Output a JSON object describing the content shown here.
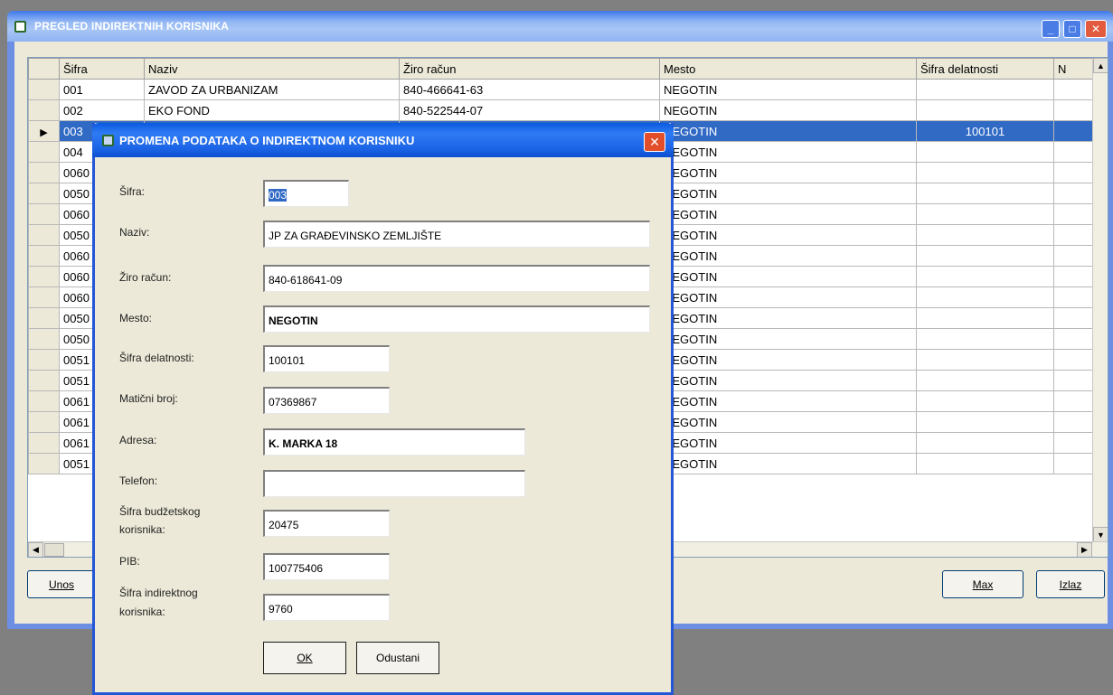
{
  "main_window": {
    "title": "PREGLED INDIREKTNIH KORISNIKA",
    "columns": [
      "Šifra",
      "Naziv",
      "Žiro račun",
      "Mesto",
      "Šifra delatnosti",
      "N"
    ],
    "rows": [
      {
        "sifra": "001",
        "naziv": "ZAVOD ZA URBANIZAM",
        "ziro": "840-466641-63",
        "mesto": "NEGOTIN",
        "delatnost": ""
      },
      {
        "sifra": "002",
        "naziv": "EKO FOND",
        "ziro": "840-522544-07",
        "mesto": "NEGOTIN",
        "delatnost": ""
      },
      {
        "sifra": "003",
        "naziv": "",
        "ziro": "",
        "mesto": "NEGOTIN",
        "delatnost": "100101"
      },
      {
        "sifra": "004",
        "naziv": "",
        "ziro": "",
        "mesto": "NEGOTIN",
        "delatnost": ""
      },
      {
        "sifra": "0060",
        "naziv": "",
        "ziro": "",
        "mesto": "NEGOTIN",
        "delatnost": ""
      },
      {
        "sifra": "0050",
        "naziv": "",
        "ziro": "",
        "mesto": "NEGOTIN",
        "delatnost": ""
      },
      {
        "sifra": "0060",
        "naziv": "",
        "ziro": "",
        "mesto": "NEGOTIN",
        "delatnost": ""
      },
      {
        "sifra": "0050",
        "naziv": "",
        "ziro": "",
        "mesto": "NEGOTIN",
        "delatnost": ""
      },
      {
        "sifra": "0060",
        "naziv": "",
        "ziro": "",
        "mesto": "NEGOTIN",
        "delatnost": ""
      },
      {
        "sifra": "0060",
        "naziv": "",
        "ziro": "",
        "mesto": "NEGOTIN",
        "delatnost": ""
      },
      {
        "sifra": "0060",
        "naziv": "",
        "ziro": "",
        "mesto": "NEGOTIN",
        "delatnost": ""
      },
      {
        "sifra": "0050",
        "naziv": "",
        "ziro": "",
        "mesto": "NEGOTIN",
        "delatnost": ""
      },
      {
        "sifra": "0050",
        "naziv": "",
        "ziro": "",
        "mesto": "NEGOTIN",
        "delatnost": ""
      },
      {
        "sifra": "0051",
        "naziv": "",
        "ziro": "",
        "mesto": "NEGOTIN",
        "delatnost": ""
      },
      {
        "sifra": "0051",
        "naziv": "",
        "ziro": "",
        "mesto": "NEGOTIN",
        "delatnost": ""
      },
      {
        "sifra": "0061",
        "naziv": "",
        "ziro": "",
        "mesto": "NEGOTIN",
        "delatnost": ""
      },
      {
        "sifra": "0061",
        "naziv": "",
        "ziro": "",
        "mesto": "NEGOTIN",
        "delatnost": ""
      },
      {
        "sifra": "0061",
        "naziv": "",
        "ziro": "",
        "mesto": "NEGOTIN",
        "delatnost": ""
      },
      {
        "sifra": "0051",
        "naziv": "",
        "ziro": "",
        "mesto": "NEGOTIN",
        "delatnost": ""
      }
    ],
    "buttons": {
      "unos": "Unos",
      "max": "Max",
      "izlaz": "Izlaz"
    }
  },
  "dialog": {
    "title": "PROMENA PODATAKA O INDIREKTNOM KORISNIKU",
    "fields": {
      "sifra": {
        "label": "Šifra:",
        "value": "003"
      },
      "naziv": {
        "label": "Naziv:",
        "value": "JP ZA GRAĐEVINSKO ZEMLJIŠTE"
      },
      "ziro": {
        "label": "Žiro račun:",
        "value": "840-618641-09"
      },
      "mesto": {
        "label": "Mesto:",
        "value": "NEGOTIN"
      },
      "delatnost": {
        "label": "Šifra delatnosti:",
        "value": "100101"
      },
      "maticni": {
        "label": "Matični broj:",
        "value": "07369867"
      },
      "adresa": {
        "label": "Adresa:",
        "value": "K. MARKA 18"
      },
      "telefon": {
        "label": "Telefon:",
        "value": ""
      },
      "budzetski_1": {
        "label": "Šifra budžetskog"
      },
      "budzetski_2": {
        "label": "korisnika:",
        "value": "20475"
      },
      "pib": {
        "label": "PIB:",
        "value": "100775406"
      },
      "indirektni_1": {
        "label": "Šifra indirektnog"
      },
      "indirektni_2": {
        "label": "korisnika:",
        "value": "9760"
      }
    },
    "buttons": {
      "ok": "OK",
      "cancel": "Odustani"
    }
  }
}
